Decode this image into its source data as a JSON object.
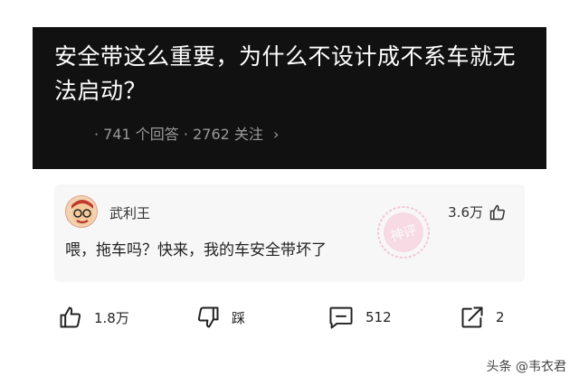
{
  "question": {
    "title": "安全带这么重要，为什么不设计成不系车就无法启动？",
    "answers_count": "· 741 个回答",
    "follow_count": "· 2762 关注",
    "chevron": "›"
  },
  "answer": {
    "author": "武利王",
    "likes": "3.6万",
    "text": "喂，拖车吗？快来，我的车安全带坏了",
    "stamp_text": "神评",
    "stamp_color": "#f2a0b8"
  },
  "actions": {
    "like_count": "1.8万",
    "dislike_label": "踩",
    "comment_count": "512",
    "share_count": "2"
  },
  "watermark": {
    "text": "头条 @韦衣君"
  },
  "icons": [
    "thumb-up-icon",
    "thumb-down-icon",
    "comment-icon",
    "share-icon"
  ]
}
